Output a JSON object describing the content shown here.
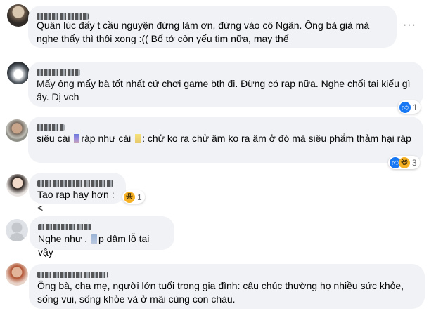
{
  "comments": [
    {
      "author": "Quân Ng...",
      "text": "Quân lúc đấy t cầu nguyện đừng làm ơn, đừng vào cô Ngân. Ông bà già mà nghe thấy thì thôi xong :(( Bố tớ còn yếu tim nữa, may thế",
      "more_icon": "···"
    },
    {
      "author": "Ph... H...",
      "text": "Mấy ông mấy bà tốt nhất cứ chơi game bth đi. Đừng có rap nữa. Nghe chối tai kiểu gì ấy. Dị vch",
      "reaction": {
        "icon": "like-icon",
        "count": "1"
      }
    },
    {
      "author": "Tùng Tr...",
      "text_before": "siêu cái",
      "text_mid": "ráp như cái",
      "text_after": ": chử ko ra chử âm ko ra âm ở đó mà siêu phẩm thảm hại ráp",
      "reaction": {
        "icon": "like-haha-icon",
        "count": "3"
      }
    },
    {
      "author": "Lê Thị Ngọc Tuyền",
      "text": "Tao rap hay hơn :<",
      "reaction": {
        "icon": "haha-icon",
        "count": "1"
      }
    },
    {
      "author": "Nam Nguyễn",
      "text_before": "Nghe như .",
      "text_after": "p dâm lỗ tai vậy"
    },
    {
      "author": "Nguyễn Văn ... ...",
      "text": "Ông bà, cha mẹ, người lớn tuổi trong gia đình: câu chúc thường họ nhiều sức khỏe, sống vui, sống khỏe và ở mãi cùng con cháu."
    }
  ]
}
